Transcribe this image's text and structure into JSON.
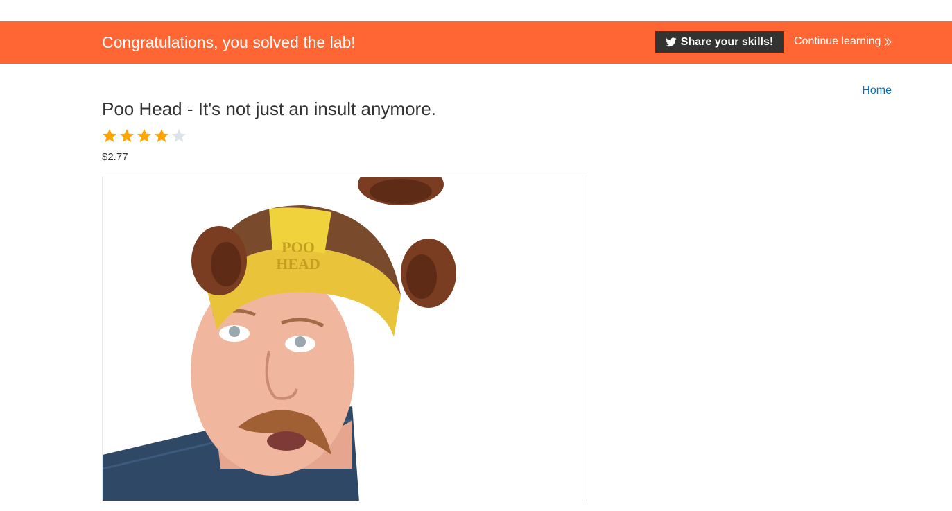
{
  "banner": {
    "message": "Congratulations, you solved the lab!",
    "share_label": "Share your skills!",
    "continue_label": "Continue learning",
    "background_color": "#ff6633"
  },
  "nav": {
    "home_label": "Home"
  },
  "product": {
    "title": "Poo Head - It's not just an insult anymore.",
    "rating": 4,
    "rating_max": 5,
    "price": "$2.77",
    "hat_text_line1": "POO",
    "hat_text_line2": "HEAD"
  },
  "icons": {
    "share": "twitter-icon",
    "continue": "double-chevron-right-icon",
    "star_filled": "star-filled-icon",
    "star_empty": "star-empty-icon"
  },
  "colors": {
    "link": "#0071bc",
    "star_filled": "#ffa500",
    "star_empty": "#dde3ea",
    "button_dark": "#333332"
  }
}
